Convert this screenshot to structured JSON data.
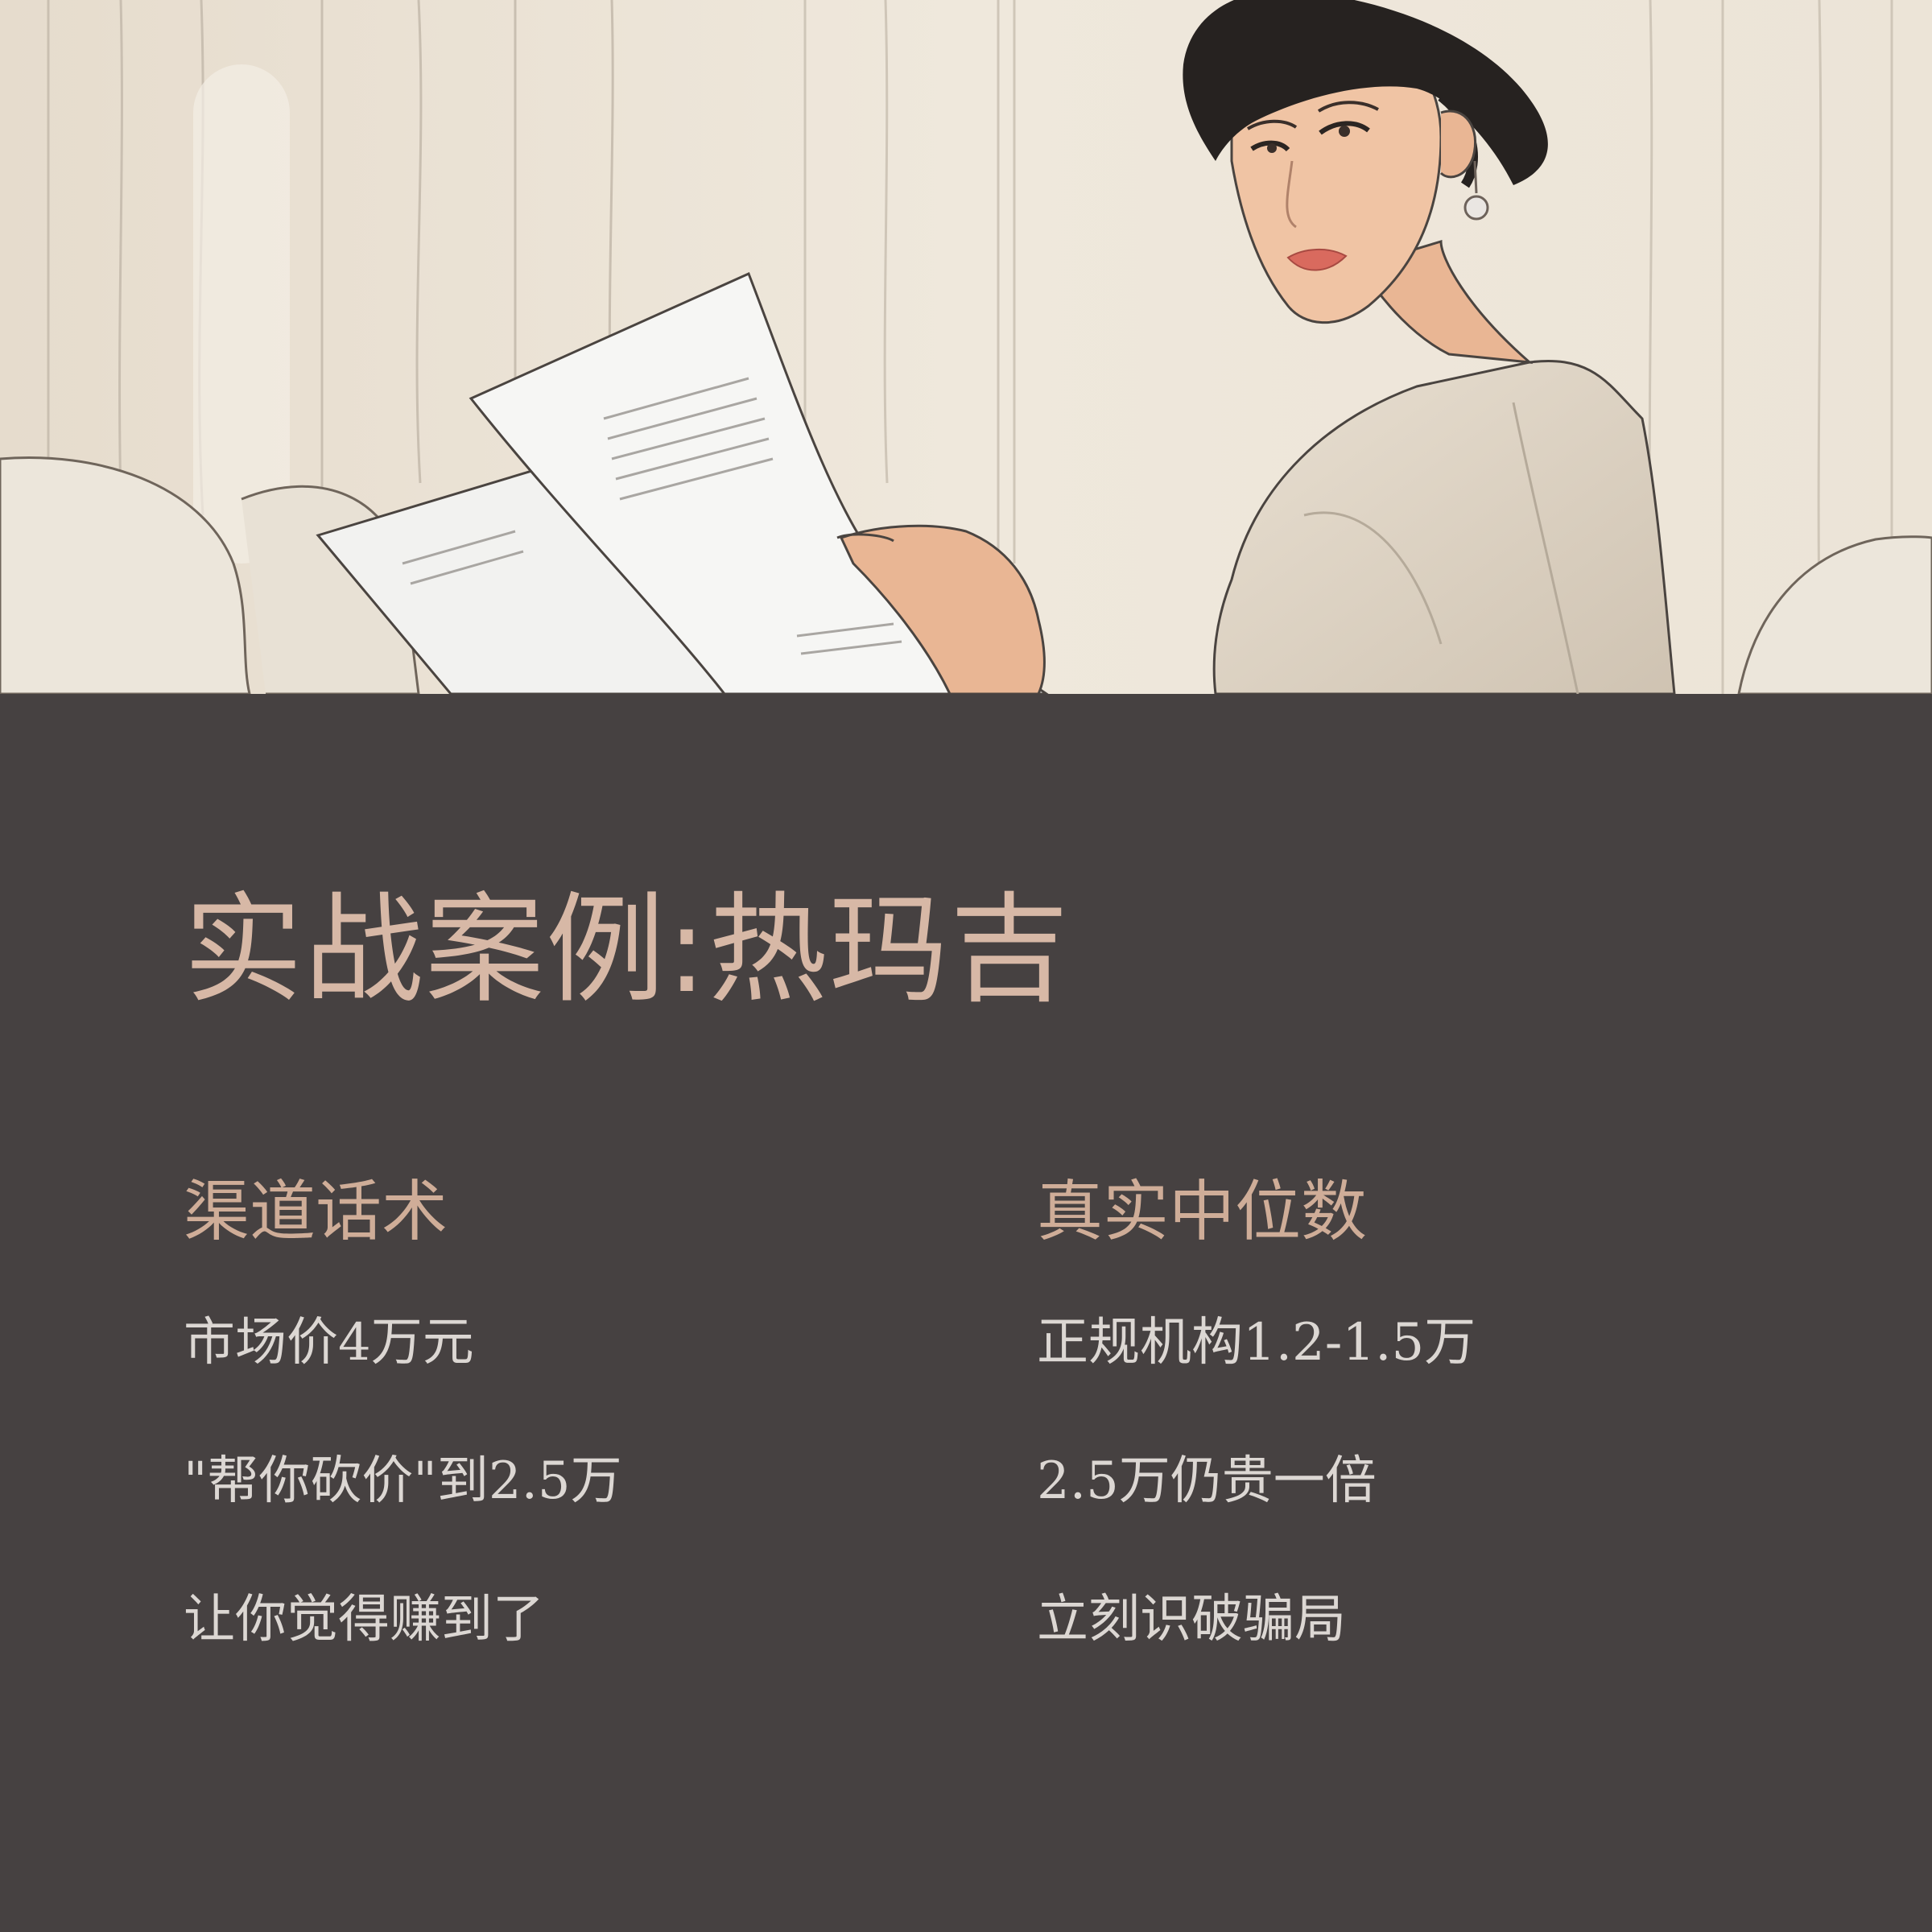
{
  "title": "实战案例:热玛吉",
  "colors": {
    "background": "#464141",
    "title": "#d7b8a6",
    "heading": "#cfad98",
    "body_text": "#dcd7d3"
  },
  "illustration": {
    "name": "woman-reading-document-illustration"
  },
  "columns": [
    {
      "heading": "渠道话术",
      "items": [
        "市场价4万元",
        "\"帮你砍价\"到2.5万",
        "让你觉得赚到了"
      ]
    },
    {
      "heading": "真实中位数",
      "items": [
        "正规机构1.2-1.5万",
        "2.5万仍贵一倍",
        "立刻识破骗局"
      ]
    }
  ]
}
